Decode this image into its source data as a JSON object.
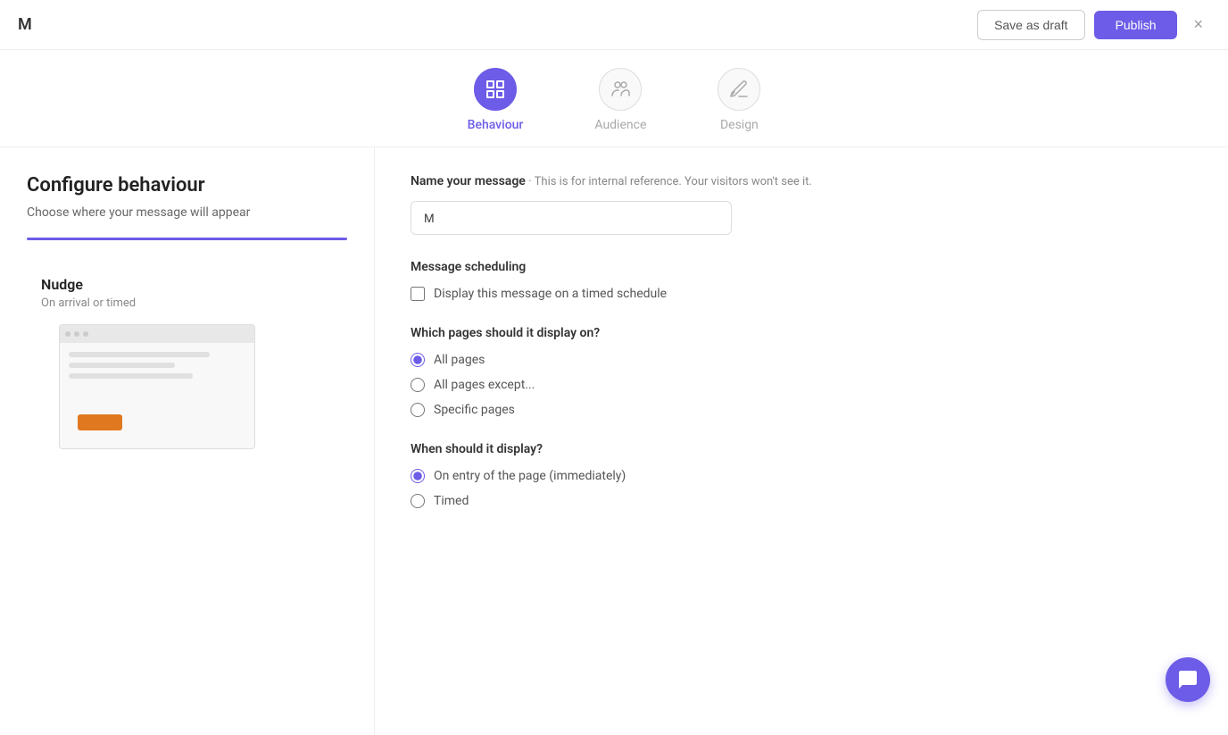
{
  "header": {
    "logo": "M",
    "save_draft_label": "Save as draft",
    "publish_label": "Publish",
    "close_icon": "×"
  },
  "steps": [
    {
      "id": "behaviour",
      "label": "Behaviour",
      "active": true,
      "icon": "grid-icon"
    },
    {
      "id": "audience",
      "label": "Audience",
      "active": false,
      "icon": "audience-icon"
    },
    {
      "id": "design",
      "label": "Design",
      "active": false,
      "icon": "design-icon"
    }
  ],
  "left_panel": {
    "title": "Configure behaviour",
    "subtitle": "Choose where your message will appear",
    "nudge": {
      "title": "Nudge",
      "subtitle": "On arrival or timed"
    }
  },
  "right_panel": {
    "name_section": {
      "label": "Name your message",
      "label_sub": "· This is for internal reference. Your visitors won't see it.",
      "input_value": "M",
      "input_placeholder": ""
    },
    "scheduling_section": {
      "title": "Message scheduling",
      "checkbox_label": "Display this message on a timed schedule"
    },
    "pages_section": {
      "title": "Which pages should it display on?",
      "options": [
        {
          "value": "all",
          "label": "All pages",
          "checked": true
        },
        {
          "value": "except",
          "label": "All pages except...",
          "checked": false
        },
        {
          "value": "specific",
          "label": "Specific pages",
          "checked": false
        }
      ]
    },
    "when_section": {
      "title": "When should it display?",
      "options": [
        {
          "value": "immediate",
          "label": "On entry of the page (immediately)",
          "checked": true
        },
        {
          "value": "timed",
          "label": "Timed",
          "checked": false
        }
      ]
    }
  }
}
